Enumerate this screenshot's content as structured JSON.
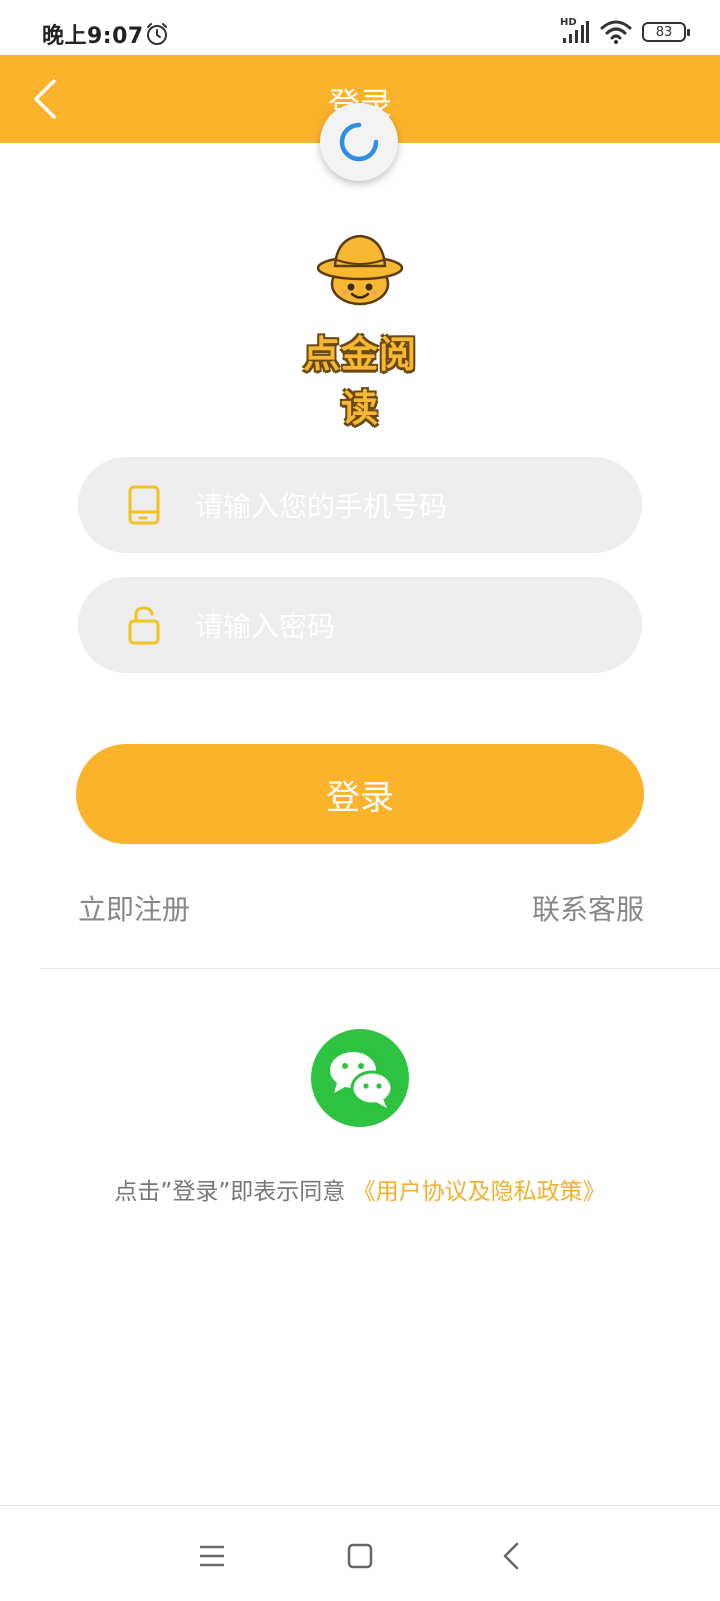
{
  "status_bar": {
    "time": "晚上9:07",
    "alarm_icon": "alarm-clock-icon",
    "signal_label": "HD",
    "signal_icon": "cellular-signal-icon",
    "wifi_icon": "wifi-icon",
    "battery_level": "83"
  },
  "header": {
    "title": "登录",
    "back_icon": "chevron-left-icon",
    "background_color": "#FBB32C"
  },
  "loading": {
    "icon": "loading-spinner-icon",
    "color": "#2F8FE6"
  },
  "logo": {
    "text": "点金阅读",
    "icon": "straw-hat-mascot-icon"
  },
  "form": {
    "phone": {
      "placeholder": "请输入您的手机号码",
      "value": "",
      "icon": "mobile-phone-icon"
    },
    "password": {
      "placeholder": "请输入密码",
      "value": "",
      "icon": "unlock-icon"
    },
    "login_label": "登录"
  },
  "links": {
    "register": "立即注册",
    "customer_service": "联系客服"
  },
  "social": {
    "wechat_icon": "wechat-icon",
    "color": "#2DC23F"
  },
  "agreement": {
    "prefix": "点击”登录”即表示同意",
    "link": "《用户协议及隐私政策》",
    "link_color": "#F1B02E"
  },
  "nav_bar": {
    "menu_icon": "menu-lines-icon",
    "home_icon": "home-square-icon",
    "back_icon": "back-chevron-icon"
  }
}
